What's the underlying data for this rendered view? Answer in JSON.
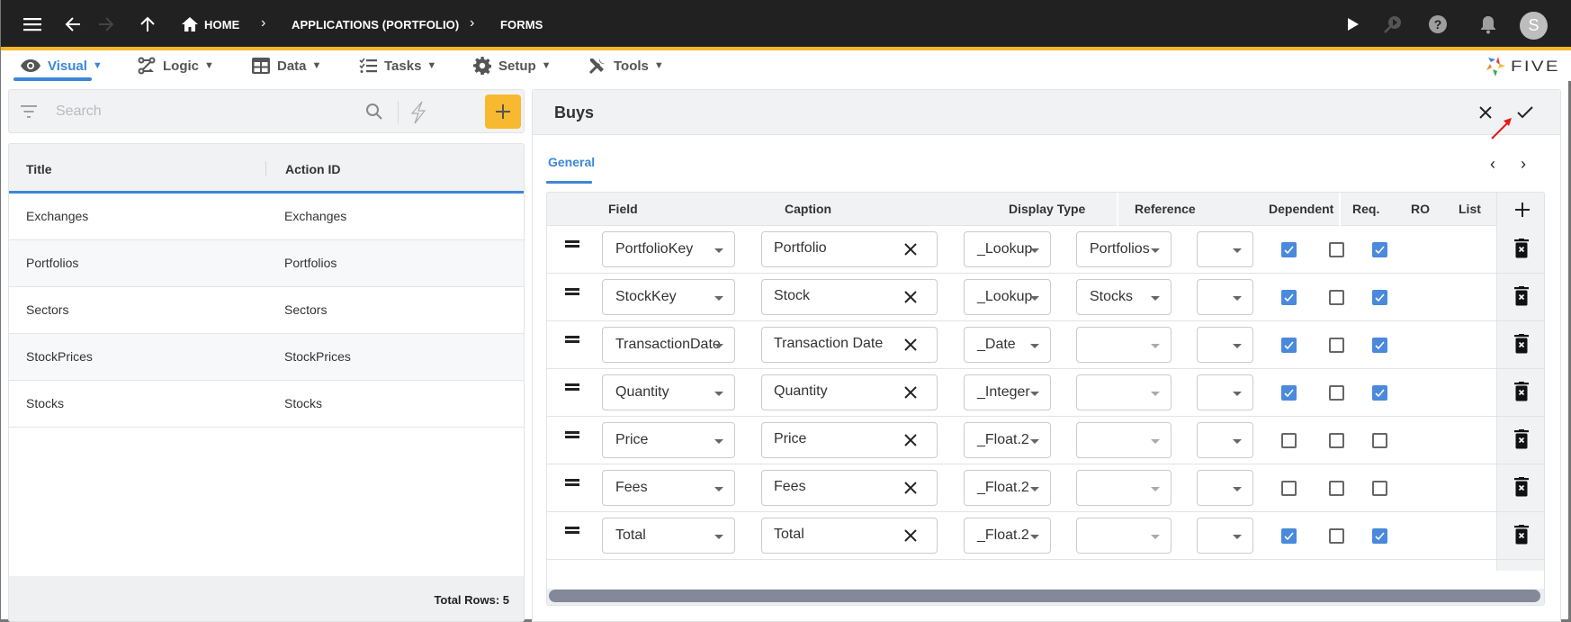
{
  "topbar": {
    "breadcrumbs": [
      {
        "label": "HOME",
        "icon": "home-icon"
      },
      {
        "label": "APPLICATIONS (PORTFOLIO)"
      },
      {
        "label": "FORMS"
      }
    ],
    "avatar_initial": "S",
    "icons": [
      "menu-icon",
      "back-arrow-icon",
      "forward-arrow-icon",
      "up-arrow-icon",
      "play-icon",
      "debug-search-icon",
      "help-icon",
      "bell-icon"
    ]
  },
  "menubar": {
    "items": [
      {
        "label": "Visual",
        "icon": "eye-icon",
        "active": true
      },
      {
        "label": "Logic",
        "icon": "logic-icon"
      },
      {
        "label": "Data",
        "icon": "table-icon"
      },
      {
        "label": "Tasks",
        "icon": "tasks-icon"
      },
      {
        "label": "Setup",
        "icon": "gear-icon"
      },
      {
        "label": "Tools",
        "icon": "tools-icon"
      }
    ],
    "caret": "▼",
    "logo_text": "FIVE"
  },
  "left_panel": {
    "search_placeholder": "Search",
    "columns": [
      "Title",
      "Action ID"
    ],
    "rows": [
      {
        "title": "Exchanges",
        "action_id": "Exchanges"
      },
      {
        "title": "Portfolios",
        "action_id": "Portfolios"
      },
      {
        "title": "Sectors",
        "action_id": "Sectors"
      },
      {
        "title": "StockPrices",
        "action_id": "StockPrices"
      },
      {
        "title": "Stocks",
        "action_id": "Stocks"
      }
    ],
    "footer": "Total Rows: 5"
  },
  "form": {
    "title": "Buys",
    "tab": "General",
    "columns": [
      "Field",
      "Caption",
      "Display Type",
      "Reference",
      "Dependent",
      "Req.",
      "RO",
      "List"
    ],
    "rows": [
      {
        "field": "PortfolioKey",
        "caption": "Portfolio",
        "display_type": "_Lookup",
        "reference": "Portfolios",
        "dependent": "",
        "req": true,
        "ro": false,
        "list": true
      },
      {
        "field": "StockKey",
        "caption": "Stock",
        "display_type": "_Lookup",
        "reference": "Stocks",
        "dependent": "",
        "req": true,
        "ro": false,
        "list": true
      },
      {
        "field": "TransactionDate",
        "caption": "Transaction Date",
        "display_type": "_Date",
        "reference": "",
        "dependent": "",
        "req": true,
        "ro": false,
        "list": true
      },
      {
        "field": "Quantity",
        "caption": "Quantity",
        "display_type": "_Integer",
        "reference": "",
        "dependent": "",
        "req": true,
        "ro": false,
        "list": true
      },
      {
        "field": "Price",
        "caption": "Price",
        "display_type": "_Float.2",
        "reference": "",
        "dependent": "",
        "req": false,
        "ro": false,
        "list": false
      },
      {
        "field": "Fees",
        "caption": "Fees",
        "display_type": "_Float.2",
        "reference": "",
        "dependent": "",
        "req": false,
        "ro": false,
        "list": false
      },
      {
        "field": "Total",
        "caption": "Total",
        "display_type": "_Float.2",
        "reference": "",
        "dependent": "",
        "req": true,
        "ro": false,
        "list": true
      }
    ]
  },
  "colors": {
    "accent": "#3b87d9",
    "topbar": "#212121",
    "topbar_border": "#f6b62a",
    "add_button": "#f7b92f",
    "checkbox_on": "#4a89dc",
    "annotation_arrow": "#e8171b"
  }
}
